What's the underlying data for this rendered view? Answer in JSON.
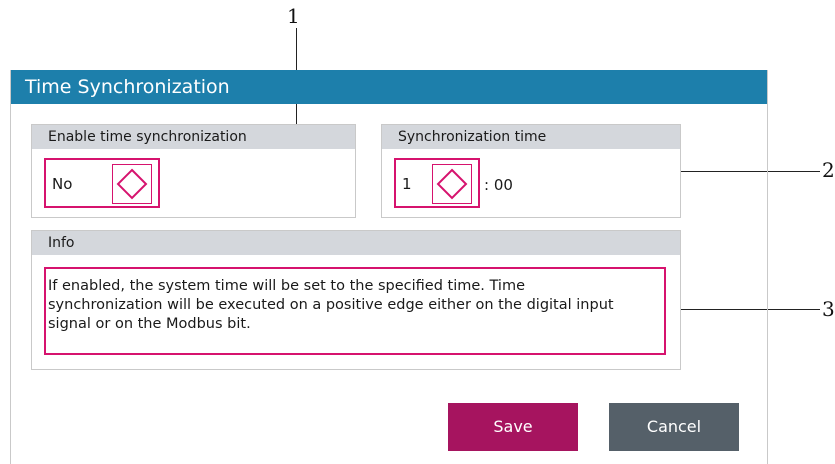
{
  "callouts": [
    "1",
    "2",
    "3"
  ],
  "dialog": {
    "title": "Time Synchronization",
    "title_bar_color": "#1d7fab",
    "enable_group": {
      "heading": "Enable time synchronization",
      "value": "No"
    },
    "sync_time_group": {
      "heading": "Synchronization time",
      "hour": "1",
      "minutes_suffix": ": 00"
    },
    "info_group": {
      "heading": "Info",
      "text": "If enabled, the system time will be set to the specified time. Time\nsynchronization will be executed on a positive edge either on the digital input\nsignal or on the Modbus bit."
    },
    "buttons": {
      "save_label": "Save",
      "cancel_label": "Cancel",
      "save_color": "#a6145f",
      "cancel_color": "#556069"
    },
    "highlight_color": "#d6136e"
  }
}
